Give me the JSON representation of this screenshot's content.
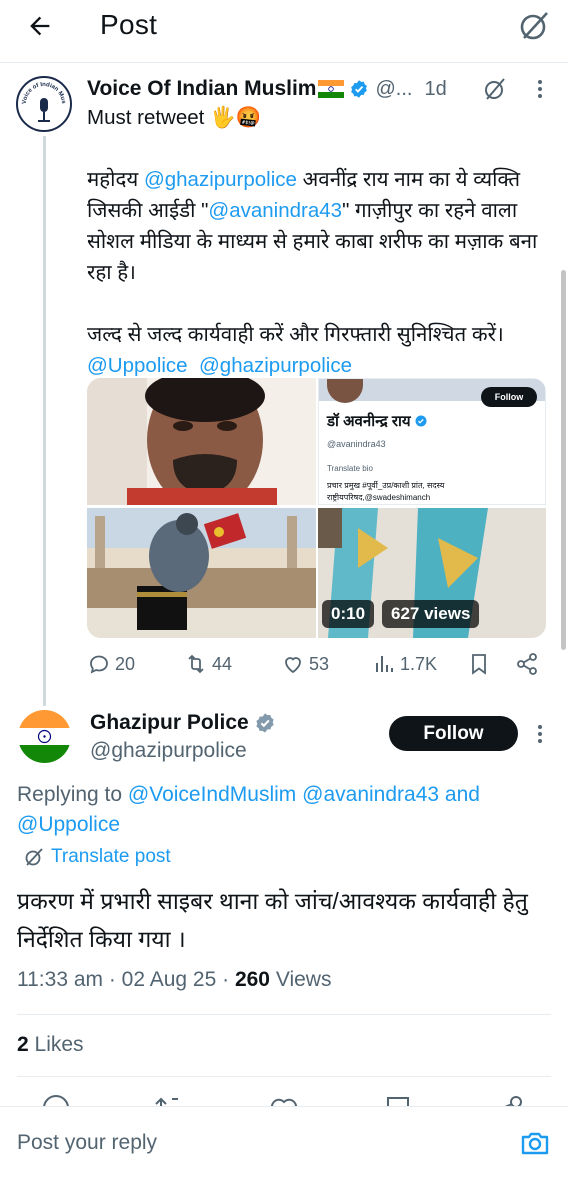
{
  "header": {
    "title": "Post"
  },
  "post1": {
    "author_name": "Voice Of Indian Muslim",
    "handle": "@...",
    "time": "1d",
    "avatar_text": "Voice of Indian Muslim",
    "text_lines": [
      "Must retweet 🖐️🤬",
      "",
      "महोदय @ghazipurpolice अवनींद्र राय नाम का ये व्यक्ति जिसकी आईडी \"@avanindra43\" गाज़ीपुर का रहने वाला सोशल मीडिया के माध्यम से हमारे काबा शरीफ का मज़ाक बना रहा है।",
      "",
      "जल्द से जल्द कार्यवाही करें और गिरफ्तारी सुनिश्चित करें।",
      "@Uppolice  @ghazipurpolice"
    ],
    "text": {
      "line1": "Must retweet 🖐️🤬",
      "para_pre": "महोदय ",
      "mention1": "@ghazipurpolice",
      "para_mid1": " अवनींद्र राय नाम का ये व्यक्ति जिसकी आईडी \"",
      "mention2": "@avanindra43",
      "para_post": "\" गाज़ीपुर का रहने वाला सोशल मीडिया के माध्यम से हमारे काबा शरीफ का मज़ाक बना रहा है।",
      "line3": "जल्द से जल्द कार्यवाही करें और गिरफ्तारी सुनिश्चित करें।",
      "mention3": "@Uppolice",
      "mention4": "@ghazipurpolice"
    },
    "media": {
      "profile_card_name": "डॉ अवनीन्द्र राय",
      "profile_card_handle": "@avanindra43",
      "profile_card_follow": "Follow",
      "profile_card_translate": "Translate bio",
      "profile_card_bio1": "प्रचार प्रमुख #पूर्वी_उप्र/काशी प्रांत, सदस्य",
      "profile_card_bio2": "राष्ट्रीयपरिषद,@swadeshimanch",
      "video_duration": "0:10",
      "video_views": "627 views"
    },
    "actions": {
      "replies": "20",
      "reposts": "44",
      "likes": "53",
      "views": "1.7K"
    }
  },
  "post2": {
    "author_name": "Ghazipur Police",
    "handle": "@ghazipurpolice",
    "follow_label": "Follow",
    "replying_prefix": "Replying to ",
    "replying_to1": "@VoiceIndMuslim",
    "replying_to2": "@avanindra43",
    "replying_and": " and",
    "replying_to3": "@Uppolice",
    "translate_label": "Translate post",
    "text": "प्रकरण में प्रभारी साइबर थाना को जांच/आवश्यक कार्यवाही हेतु निर्देशित किया गया ।",
    "time": "11:33 am",
    "date": "02 Aug 25",
    "views_count": "260",
    "views_label": "Views",
    "likes_count": "2",
    "likes_label": "Likes"
  },
  "reply_bar": {
    "placeholder": "Post your reply"
  },
  "colors": {
    "accent": "#1d9bf0",
    "text": "#0f1419",
    "muted": "#536471",
    "verified_blue": "#1d9bf0",
    "verified_gray": "#829aab"
  }
}
